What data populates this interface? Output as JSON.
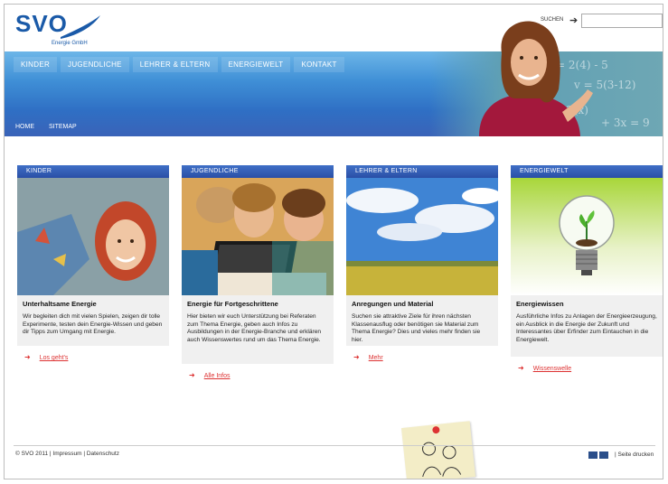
{
  "brand": {
    "name": "SVO",
    "tagline": "Energie GmbH"
  },
  "search": {
    "label": "SUCHEN",
    "placeholder": ""
  },
  "main_nav": [
    "KINDER",
    "JUGENDLICHE",
    "LEHRER & ELTERN",
    "ENERGIEWELT",
    "KONTAKT"
  ],
  "sub_nav": [
    "HOME",
    "SITEMAP"
  ],
  "chalk": [
    "= 2(4) - 5",
    "v = 5(3-12)",
    "Q(x)",
    "+ 3x = 9"
  ],
  "columns": [
    {
      "header": "KINDER",
      "title": "Unterhaltsame Energie",
      "text": "Wir begleiten dich mit vielen Spielen, zeigen dir tolle Experimente, testen dein Energie-Wissen und geben dir Tipps zum Umgang mit Energie.",
      "link": "Los geht's"
    },
    {
      "header": "JUGENDLICHE",
      "title": "Energie für Fortgeschrittene",
      "text": "Hier bieten wir euch Unterstützung bei Referaten zum Thema Energie, geben auch Infos zu Ausbildungen in der Energie-Branche und erklären auch Wissenswertes rund um das Thema Energie.",
      "link": "Alle Infos"
    },
    {
      "header": "LEHRER & ELTERN",
      "title": "Anregungen und Material",
      "text": "Suchen sie attraktive Ziele für ihren nächsten Klassenausflug oder benötigen sie Material zum Thema Energie? Dies und vieles mehr finden sie hier.",
      "link": "Mehr"
    },
    {
      "header": "ENERGIEWELT",
      "title": "Energiewissen",
      "text": "Ausführliche Infos zu Anlagen der Energieerzeugung, ein Ausblick in die Energie der Zukunft und Interessantes über Erfinder zum Eintauchen in die Energiewelt.",
      "link": "Wissenswelle"
    }
  ],
  "footer": {
    "copyright": "© SVO 2011 | Impressum | Datenschutz",
    "print": "|  Seite drucken"
  },
  "colors": {
    "brand_blue": "#1a5aa8",
    "nav_blue": "#2f6fc4",
    "link_red": "#d33333"
  }
}
